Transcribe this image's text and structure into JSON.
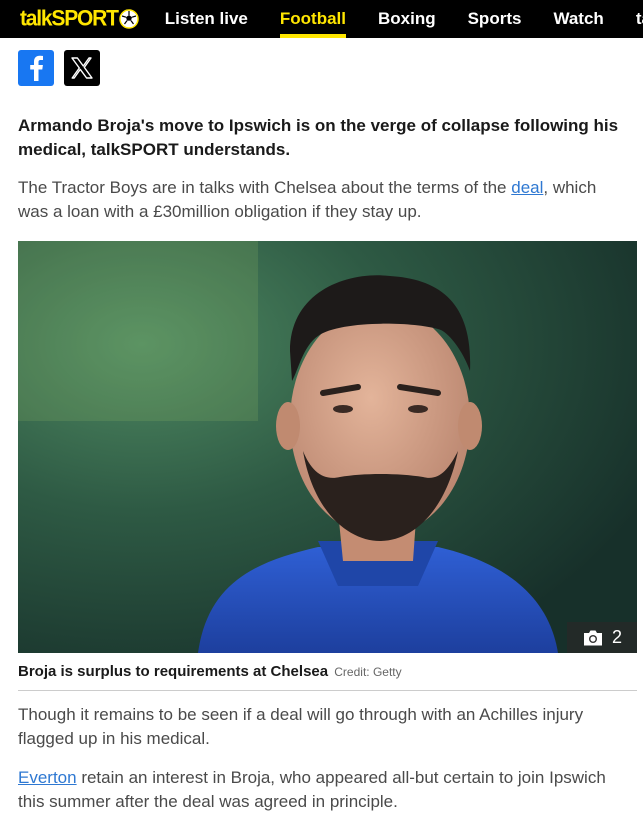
{
  "nav": {
    "logo_text": "talkSPORT",
    "items": [
      "Listen live",
      "Football",
      "Boxing",
      "Sports",
      "Watch",
      "ta"
    ],
    "active_index": 1
  },
  "share": {
    "facebook_icon": "facebook-icon",
    "x_icon": "x-icon"
  },
  "article": {
    "lead": "Armando Broja's move to Ipswich is on the verge of collapse following his medical, talkSPORT understands.",
    "para1_before": "The Tractor Boys are in talks with Chelsea about the terms of the ",
    "para1_link": "deal",
    "para1_after": ", which was a loan with a £30million obligation if they stay up.",
    "image": {
      "photo_count": "2",
      "caption": "Broja is surplus to requirements at Chelsea",
      "credit": "Credit: Getty"
    },
    "para2": "Though it remains to be seen if a deal will go through with an Achilles injury flagged up in his medical.",
    "para3_link": "Everton",
    "para3_after": " retain an interest in Broja, who appeared all-but certain to join Ipswich this summer after the deal was agreed in principle."
  },
  "colors": {
    "brand_yellow": "#ffe600",
    "nav_bg": "#000000",
    "link": "#2e78d2",
    "facebook": "#1877f2",
    "shirt_blue": "#2a57c8"
  }
}
